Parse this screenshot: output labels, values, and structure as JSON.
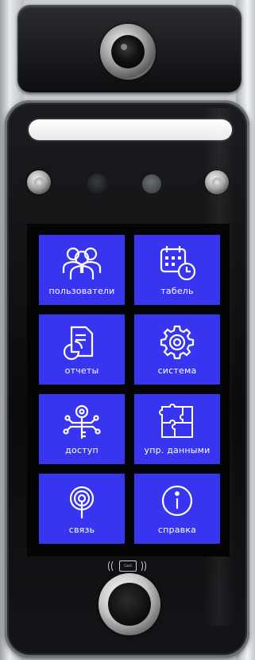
{
  "colors": {
    "tile": "#3835f0",
    "screen": "#050505",
    "label": "#ffffff"
  },
  "card_reader": {
    "label": "Card"
  },
  "menu": {
    "tiles": [
      {
        "label": "пользователи",
        "icon": "users-icon"
      },
      {
        "label": "табель",
        "icon": "calendar-clock-icon"
      },
      {
        "label": "отчеты",
        "icon": "report-icon"
      },
      {
        "label": "система",
        "icon": "gear-icon"
      },
      {
        "label": "доступ",
        "icon": "access-key-icon"
      },
      {
        "label": "упр. данными",
        "icon": "puzzle-icon"
      },
      {
        "label": "связь",
        "icon": "signal-icon"
      },
      {
        "label": "справка",
        "icon": "info-icon"
      }
    ]
  }
}
